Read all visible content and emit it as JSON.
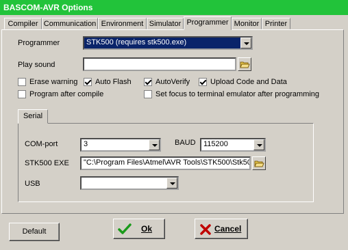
{
  "window": {
    "title": "BASCOM-AVR Options"
  },
  "tabs": [
    "Compiler",
    "Communication",
    "Environment",
    "Simulator",
    "Programmer",
    "Monitor",
    "Printer"
  ],
  "programmer": {
    "label": "Programmer",
    "value": "STK500 (requires stk500.exe)",
    "play_sound_label": "Play sound",
    "play_sound_value": ""
  },
  "checkboxes": [
    {
      "label": "Erase warning",
      "checked": false
    },
    {
      "label": "Auto Flash",
      "checked": true
    },
    {
      "label": "AutoVerify",
      "checked": true
    },
    {
      "label": "Upload Code and Data",
      "checked": true
    },
    {
      "label": "Program after compile",
      "checked": false
    },
    {
      "label": "Set focus to terminal emulator after programming",
      "checked": false
    }
  ],
  "serial": {
    "tab_label": "Serial",
    "com_label": "COM-port",
    "com_value": "3",
    "baud_label": "BAUD",
    "baud_value": "115200",
    "exe_label": "STK500 EXE",
    "exe_value": "\"C:\\Program Files\\Atmel\\AVR Tools\\STK500\\Stk50",
    "usb_label": "USB",
    "usb_value": ""
  },
  "buttons": {
    "default": "Default",
    "ok": "Ok",
    "cancel": "Cancel"
  },
  "colors": {
    "titlebar": "#22c33a",
    "selection": "#0a246a",
    "ok_icon": "#1a9a1a",
    "cancel_icon": "#c00000"
  }
}
